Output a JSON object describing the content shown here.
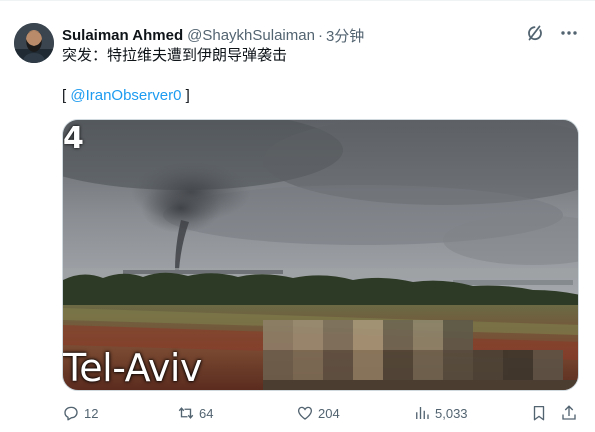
{
  "tweet": {
    "author_name": "Sulaiman Ahmed",
    "author_handle": "@ShaykhSulaiman",
    "separator": "·",
    "timestamp": "3分钟",
    "text": "突发：特拉维夫遭到伊朗导弹袭击",
    "mention_prefix": "[ ",
    "mention": "@IranObserver0",
    "mention_suffix": " ]",
    "media": {
      "caption": "Tel-Aviv",
      "corner_mark": "4"
    }
  },
  "actions": {
    "replies": "12",
    "reposts": "64",
    "likes": "204",
    "views": "5,033"
  },
  "icons": {
    "grok": "grok-icon",
    "more": "more-icon",
    "reply": "reply-icon",
    "repost": "repost-icon",
    "like": "heart-icon",
    "views": "views-icon",
    "bookmark": "bookmark-icon",
    "share": "share-icon"
  },
  "colors": {
    "link": "#1d9bf0",
    "secondary_text": "#536471",
    "primary_text": "#0f1419"
  }
}
